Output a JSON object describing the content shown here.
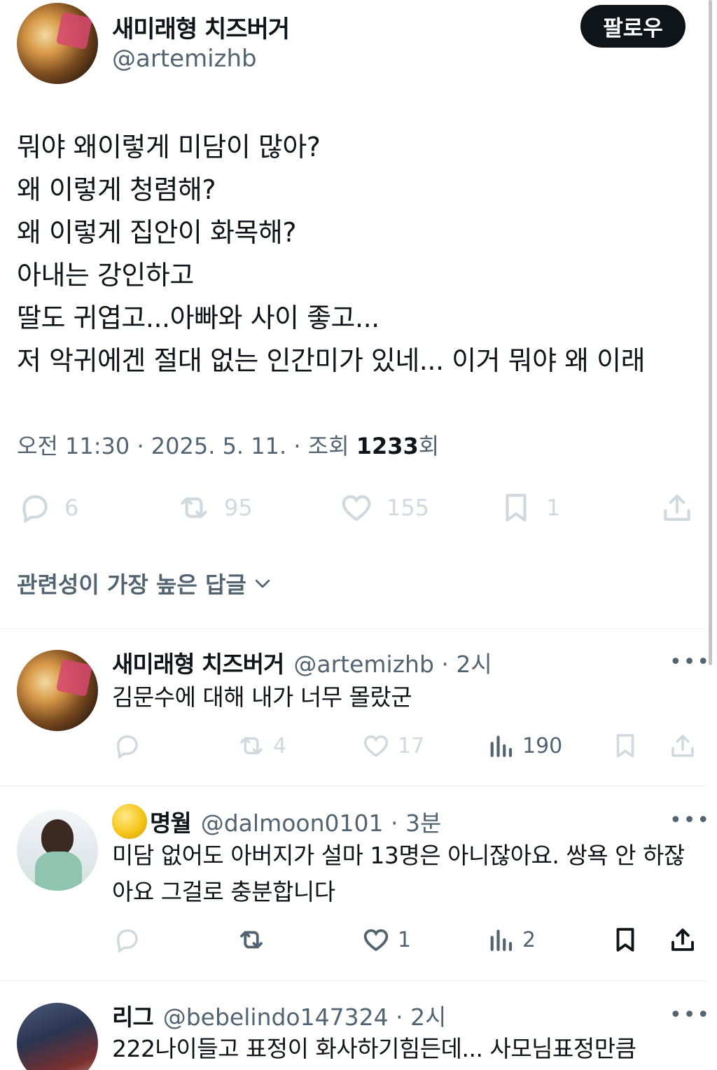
{
  "tweet": {
    "author_name": "새미래형 치즈버거",
    "author_handle": "@artemizhb",
    "follow_label": "팔로우",
    "lines": [
      "뭐야 왜이렇게 미담이 많아?",
      "왜 이렇게 청렴해?",
      "왜 이렇게 집안이 화목해?",
      "아내는 강인하고",
      "딸도 귀엽고...아빠와 사이 좋고...",
      "저 악귀에겐 절대 없는 인간미가 있네... 이거 뭐야 왜 이래"
    ],
    "time": "오전 11:30 · 2025. 5. 11. · 조회 ",
    "views": "1233",
    "views_suffix": "회",
    "actions": {
      "replies": "6",
      "retweets": "95",
      "likes": "155",
      "bookmarks": "1"
    }
  },
  "sort": {
    "label": "관련성이 가장 높은 답글"
  },
  "replies": [
    {
      "name": "새미래형 치즈버거",
      "handle": "@artemizhb · 2시",
      "text": "김문수에 대해 내가 너무 몰랐군",
      "retweets": "4",
      "likes": "17",
      "views": "190"
    },
    {
      "name": "명월",
      "handle": "@dalmoon0101 · 3분",
      "text": "미담 없어도 아버지가 설마 13명은 아니잖아요. 쌍욕 안 하잖아요 그걸로 충분합니다",
      "likes": "1",
      "views": "2"
    },
    {
      "name": "리그",
      "handle": "@bebelindo147324 · 2시",
      "text": "222나이들고 표정이 화사하기힘든데... 사모님표정만큼"
    }
  ],
  "icons": {
    "reply": "reply-icon",
    "retweet": "retweet-icon",
    "like": "heart-icon",
    "bookmark": "bookmark-icon",
    "share": "share-icon",
    "views": "views-icon",
    "more": "more-icon"
  }
}
